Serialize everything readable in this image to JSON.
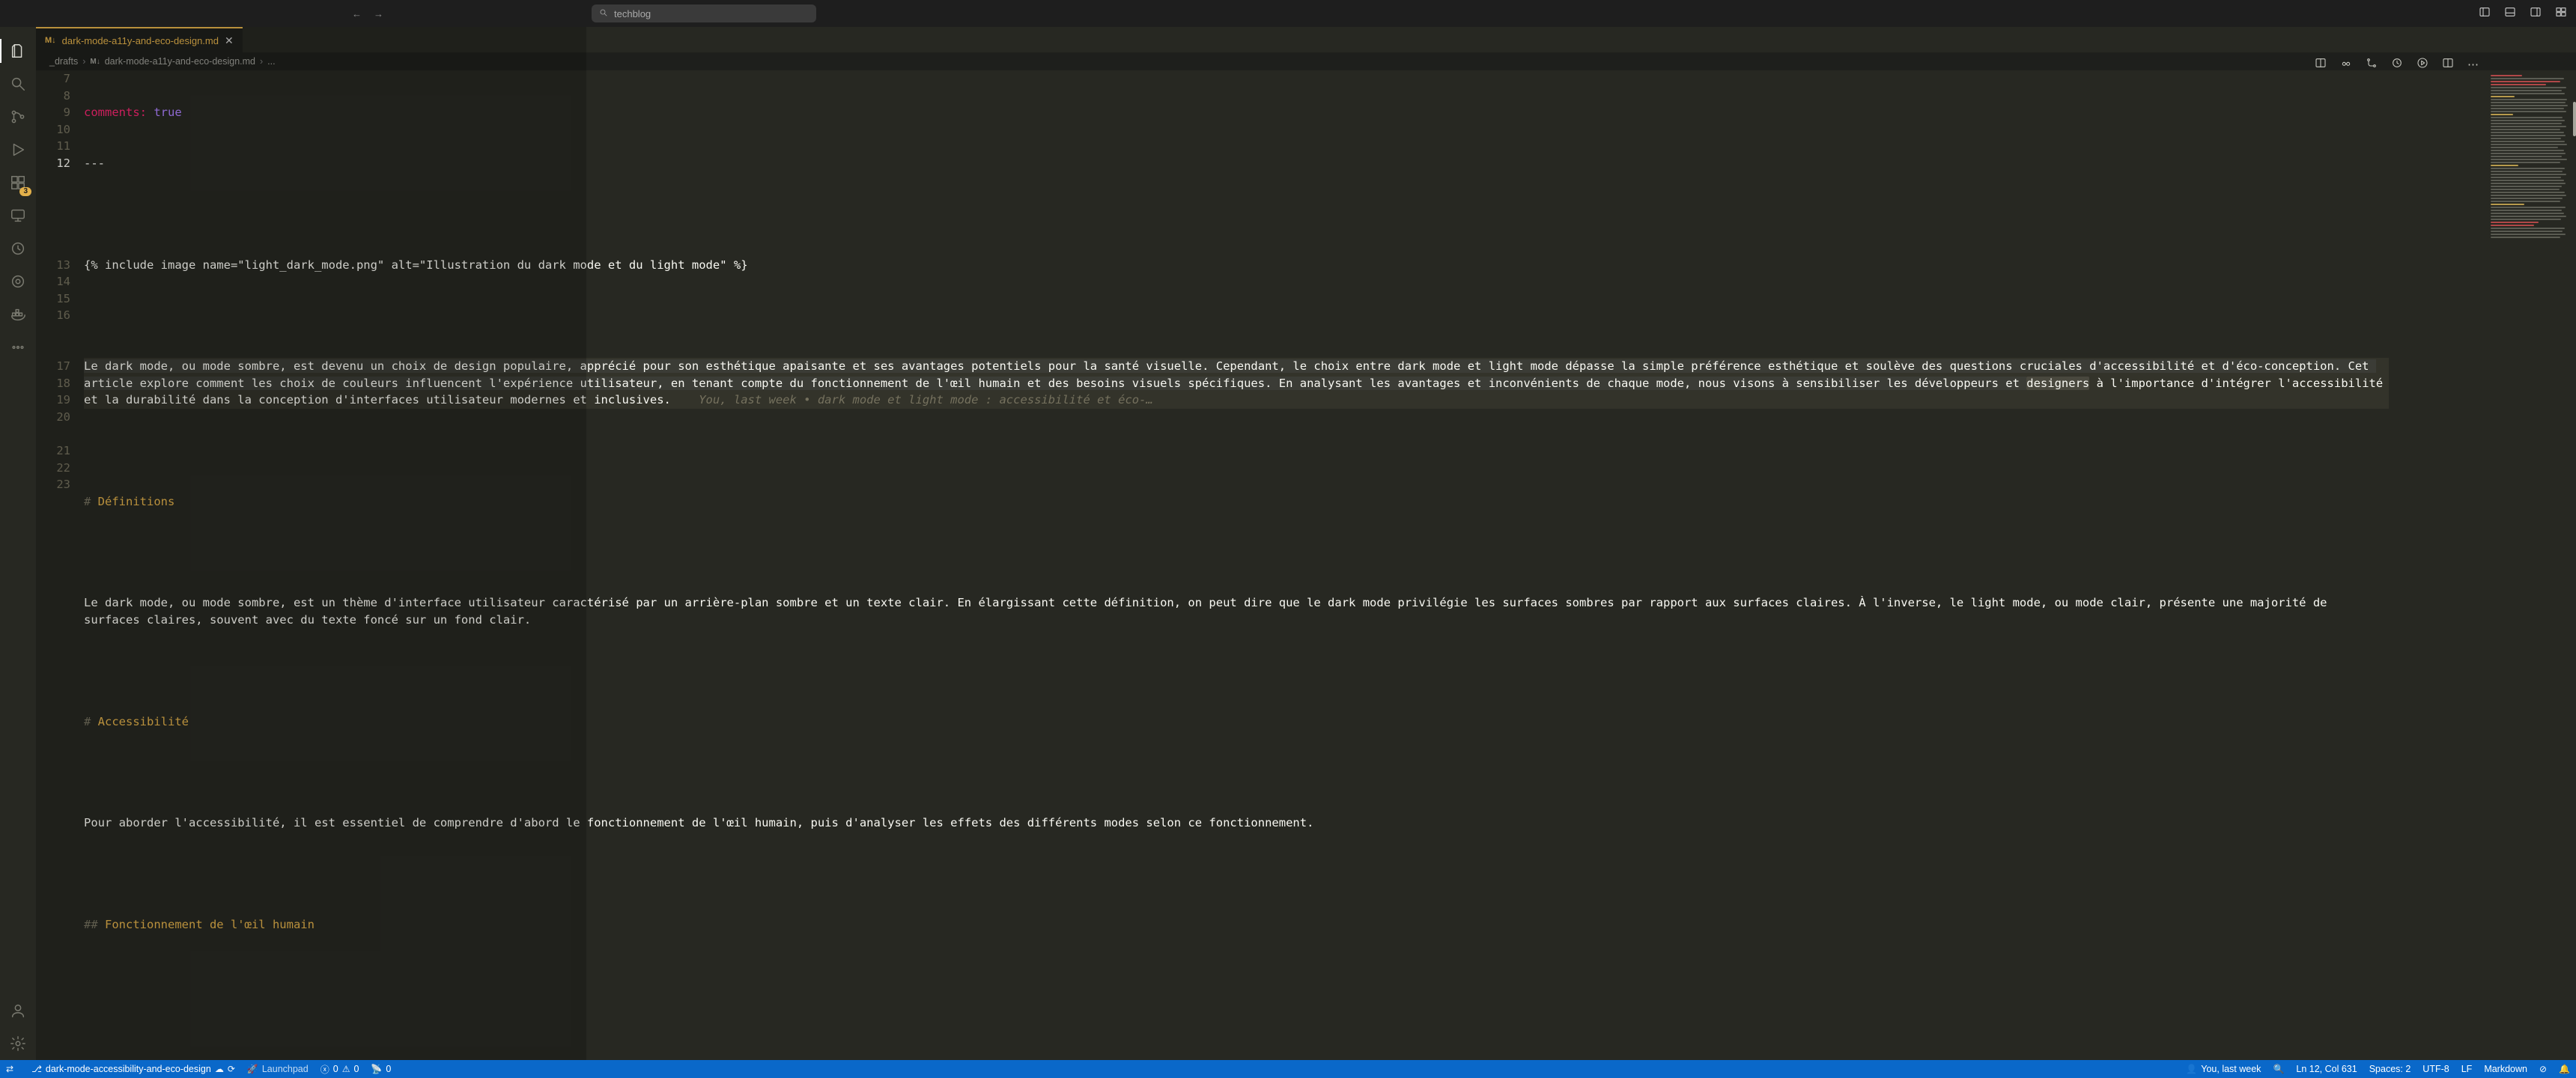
{
  "titlebar": {
    "search_text": "techblog"
  },
  "activitybar": {
    "badge_scm": "3"
  },
  "tab": {
    "pre": "M↓",
    "filename": "dark-mode-a11y-and-eco-design.md"
  },
  "breadcrumb": {
    "folder": "_drafts",
    "pre": "M↓",
    "file": "dark-mode-a11y-and-eco-design.md",
    "tail": "..."
  },
  "gutter": {
    "start": 7,
    "end": 23,
    "current": 12
  },
  "lines": {
    "l7a": "comments:",
    "l7b": " true",
    "l8": "---",
    "l9": "",
    "l10": "{% include image name=\"light_dark_mode.png\" alt=\"Illustration du dark mode et du light mode\" %}",
    "l11": "",
    "l12": "Le dark mode, ou mode sombre, est devenu un choix de design populaire, apprécié pour son esthétique apaisante et ses avantages potentiels pour la santé visuelle. Cependant, le choix entre dark mode et light mode dépasse la simple préférence esthétique et soulève des questions cruciales d'accessibilité et d'éco-conception. Cet article explore comment les choix de couleurs influencent l'expérience utilisateur, en tenant compte du fonctionnement de l'œil humain et des besoins visuels spécifiques. En analysant les avantages et inconvénients de chaque mode, nous visons à sensibiliser les développeurs et ",
    "l12_sel": "designers",
    "l12_tail": " à l'importance d'intégrer l'accessibilité et la durabilité dans la conception d'interfaces utilisateur modernes et inclusives.",
    "l12_blame": "    You, last week • dark mode et light mode : accessibilité et éco-…",
    "l13": "",
    "l14_hash": "# ",
    "l14_head": "Définitions",
    "l15": "",
    "l16": "Le dark mode, ou mode sombre, est un thème d'interface utilisateur caractérisé par un arrière-plan sombre et un texte clair. En élargissant cette définition, on peut dire que le dark mode privilégie les surfaces sombres par rapport aux surfaces claires. À l'inverse, le light mode, ou mode clair, présente une majorité de surfaces claires, souvent avec du texte foncé sur un fond clair.",
    "l17": "",
    "l18_hash": "# ",
    "l18_head": "Accessibilité",
    "l19": "",
    "l20": "Pour aborder l'accessibilité, il est essentiel de comprendre d'abord le fonctionnement de l'œil humain, puis d'analyser les effets des différents modes selon ce fonctionnement.",
    "l21": "",
    "l22_hash": "## ",
    "l22_head": "Fonctionnement de l'œil humain",
    "l23": ""
  },
  "statusbar": {
    "branch": "dark-mode-accessibility-and-eco-design",
    "launchpad": "Launchpad",
    "errors": "0",
    "warnings": "0",
    "ports": "0",
    "blame": "You, last week",
    "lncol": "Ln 12, Col 631",
    "spaces": "Spaces: 2",
    "encoding": "UTF-8",
    "eol": "LF",
    "lang": "Markdown"
  }
}
